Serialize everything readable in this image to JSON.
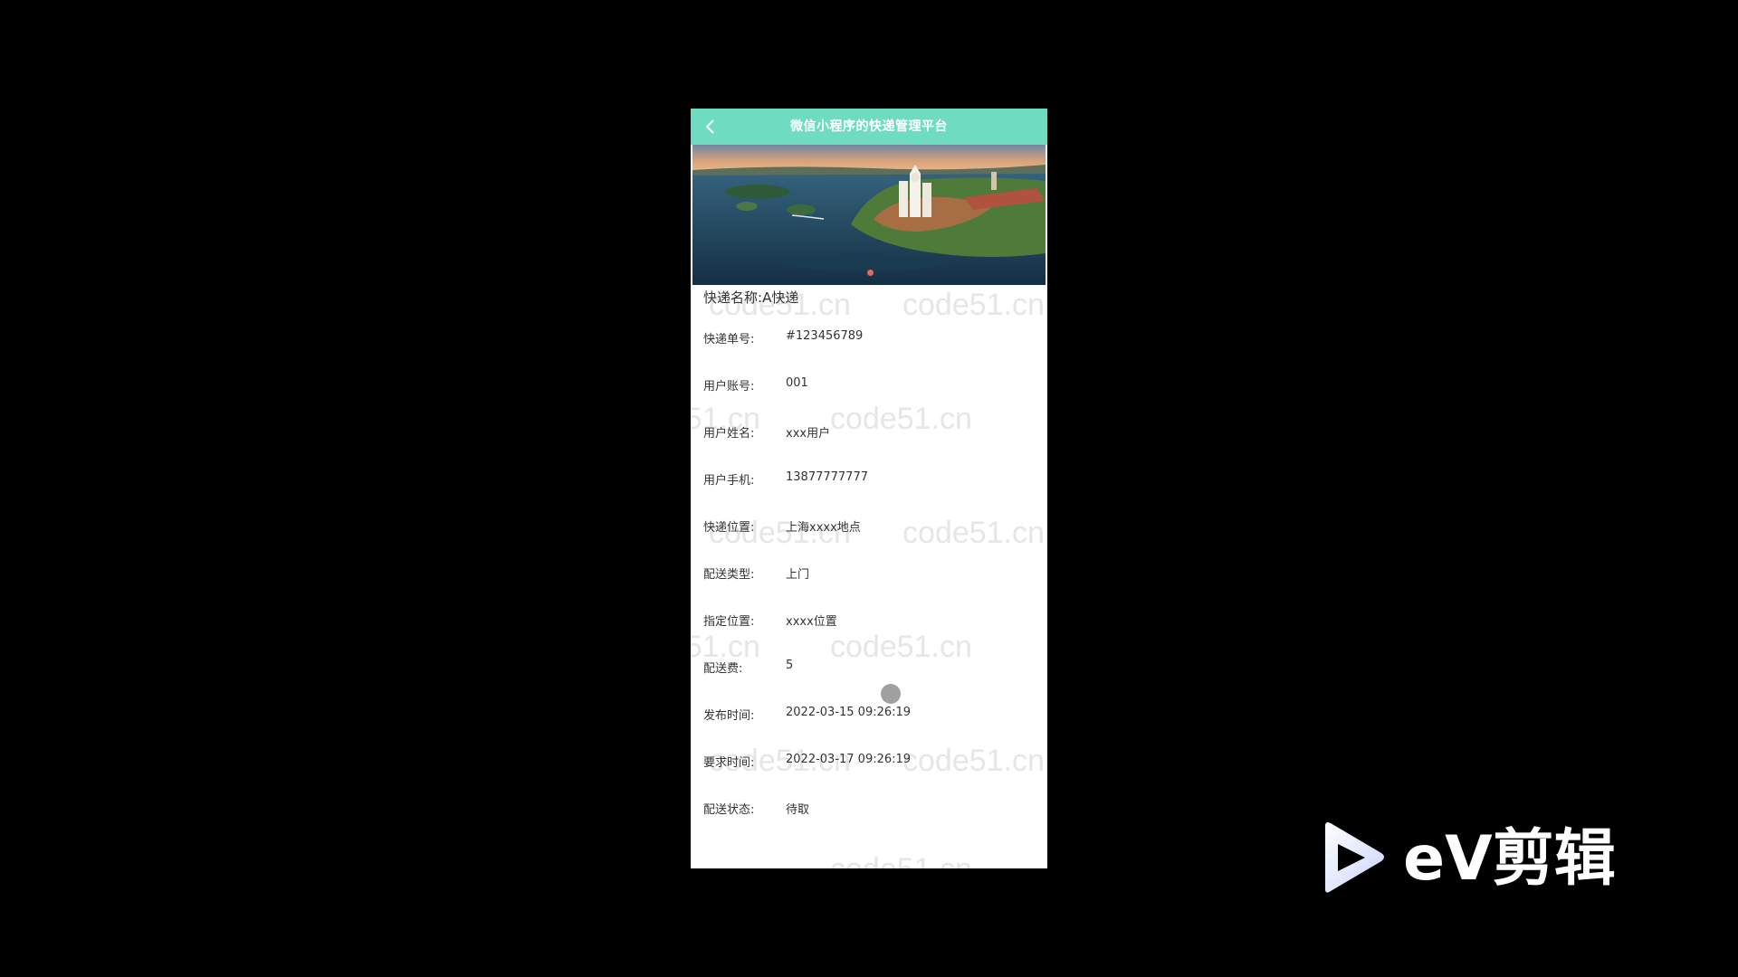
{
  "nav": {
    "back_icon": "chevron-left-icon",
    "title": "微信小程序的快递管理平台",
    "color": "#6fdcc1"
  },
  "banner": {
    "description_icon": "lake-castle-photo",
    "active_slide": 1,
    "dot_color": "#e06a6a"
  },
  "express_name": {
    "label": "快递名称:",
    "value": "A快递"
  },
  "fields": [
    {
      "label": "快递单号:",
      "value": "#123456789"
    },
    {
      "label": "用户账号:",
      "value": "001"
    },
    {
      "label": "用户姓名:",
      "value": "xxx用户"
    },
    {
      "label": "用户手机:",
      "value": "13877777777"
    },
    {
      "label": "快递位置:",
      "value": "上海xxxx地点"
    },
    {
      "label": "配送类型:",
      "value": "上门"
    },
    {
      "label": "指定位置:",
      "value": "xxxx位置"
    },
    {
      "label": "配送费:",
      "value": "5"
    },
    {
      "label": "发布时间:",
      "value": "2022-03-15 09:26:19"
    },
    {
      "label": "要求时间:",
      "value": "2022-03-17 09:26:19"
    },
    {
      "label": "配送状态:",
      "value": "待取"
    }
  ],
  "watermark": "code51.cn",
  "overlay": {
    "logo_icon": "play-icon",
    "brand": "eV剪辑"
  }
}
